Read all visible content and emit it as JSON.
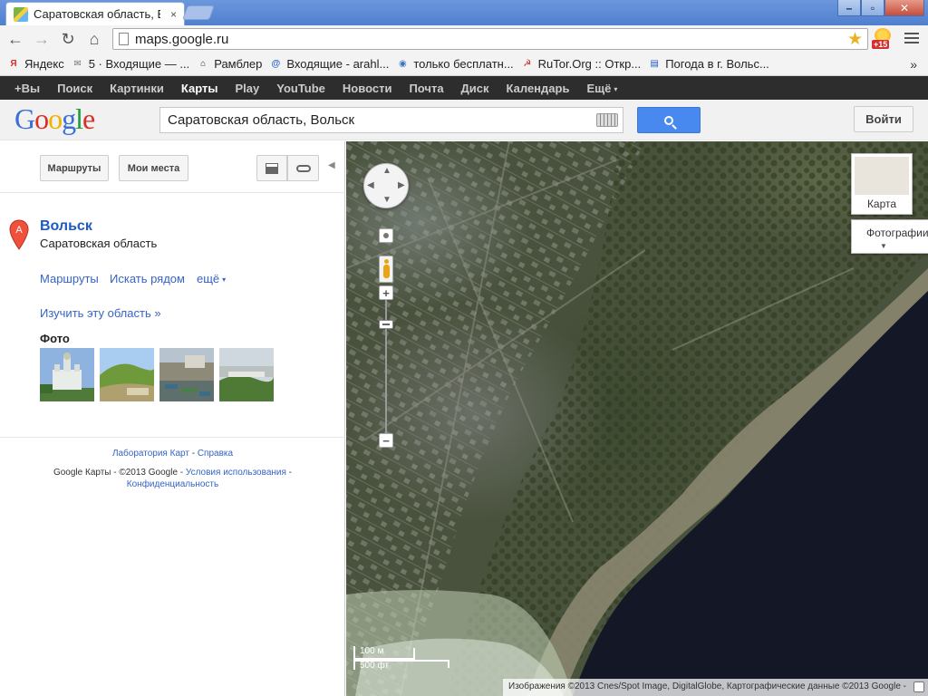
{
  "browser": {
    "tab_title": "Саратовская область, В",
    "tab_close": "×",
    "url": "maps.google.ru",
    "ext_badge": "+15",
    "window_buttons": {
      "minimize": "–",
      "maximize": "▫",
      "close": "✕"
    },
    "nav": {
      "back": "←",
      "forward": "→",
      "reload": "↻",
      "home": "⌂"
    },
    "star": "★"
  },
  "bookmarks": [
    {
      "label": "Яндекс",
      "icon": "yandex-icon",
      "icon_char": "Я",
      "color": "#d32f2f"
    },
    {
      "label": "5 · Входящие — ...",
      "icon": "mail-icon",
      "icon_char": "✉",
      "color": "#777777"
    },
    {
      "label": "Рамблер",
      "icon": "home-icon",
      "icon_char": "⌂",
      "color": "#333333"
    },
    {
      "label": "Входящие - arahl...",
      "icon": "mailru-icon",
      "icon_char": "@",
      "color": "#2a6ac9"
    },
    {
      "label": "только бесплатн...",
      "icon": "globe-icon",
      "icon_char": "◉",
      "color": "#3a76c4"
    },
    {
      "label": "RuTor.Org :: Откр...",
      "icon": "rutor-icon",
      "icon_char": "☭",
      "color": "#c62828"
    },
    {
      "label": "Погода в г. Вольс...",
      "icon": "flag-icon",
      "icon_char": "▤",
      "color": "#1e56c6"
    }
  ],
  "bookmarks_more": "»",
  "gbar": {
    "items": [
      "+Вы",
      "Поиск",
      "Картинки",
      "Карты",
      "Play",
      "YouTube",
      "Новости",
      "Почта",
      "Диск",
      "Календарь"
    ],
    "active": "Карты",
    "more_label": "Ещё",
    "caret": "▾"
  },
  "header": {
    "logo": [
      "G",
      "o",
      "o",
      "g",
      "l",
      "e"
    ],
    "logo_colors": [
      "#3a6fd8",
      "#d93025",
      "#f0b400",
      "#3a6fd8",
      "#1e9e3b",
      "#d93025"
    ],
    "search_value": "Саратовская область, Вольск",
    "signin_label": "Войти"
  },
  "panel": {
    "routes_button": "Маршруты",
    "my_places_button": "Мои места",
    "collapse": "◀",
    "marker_letter": "A",
    "place_title": "Вольск",
    "place_subtitle": "Саратовская область",
    "links": {
      "routes": "Маршруты",
      "nearby": "Искать рядом",
      "more": "ещё",
      "more_caret": "▾"
    },
    "explore_link": "Изучить эту область »",
    "photos_label": "Фото",
    "footer": {
      "lab": "Лаборатория Карт",
      "sep": " - ",
      "help": "Справка",
      "copyright": "Google Карты - ©2013 Google - ",
      "terms": "Условия использования",
      "trail": " -",
      "privacy": "Конфиденциальность"
    }
  },
  "map": {
    "nav_arrows": {
      "up": "▲",
      "down": "▼",
      "left": "◀",
      "right": "▶"
    },
    "zoom_in": "+",
    "zoom_out": "−",
    "zoom_out2": "−",
    "map_type_label": "Карта",
    "photos_toggle_label": "Фотографии",
    "photos_toggle_caret": "▼",
    "scale_metric": "100 м",
    "scale_imperial": "500 фт",
    "attribution": "Изображения ©2013 Cnes/Spot Image, DigitalGlobe, Картографические данные ©2013 Google -"
  }
}
